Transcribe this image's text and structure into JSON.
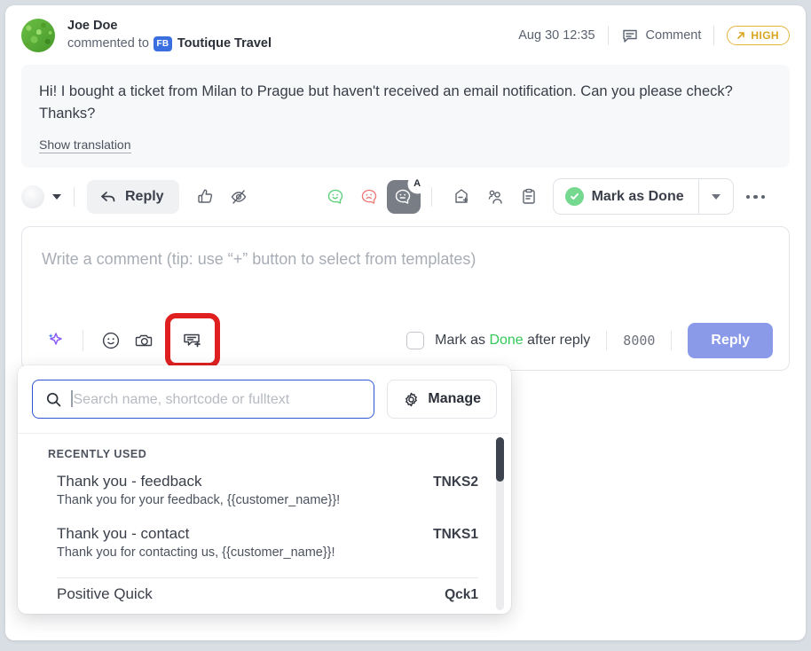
{
  "header": {
    "user_name": "Joe Doe",
    "action_text": "commented to",
    "channel_badge": "FB",
    "channel_name": "Toutique Travel",
    "timestamp": "Aug 30 12:35",
    "type_label": "Comment",
    "priority_label": "HIGH",
    "priority_color": "#d9a520"
  },
  "message": {
    "body": "Hi! I bought a ticket from Milan to Prague but haven't received an email notification. Can you please check? Thanks?",
    "translate_link": "Show translation"
  },
  "toolbar": {
    "reply_label": "Reply",
    "mark_done_label": "Mark as Done",
    "icons": {
      "like": "thumbs-up-icon",
      "hide": "eye-off-icon",
      "positive": "happy-face-bubble-icon",
      "negative": "sad-face-bubble-icon",
      "neutral": "neutral-face-bubble-icon",
      "neutral_badge": "A",
      "tag": "add-tag-icon",
      "assign": "assign-user-icon",
      "notes": "clipboard-icon",
      "more": "more-options-icon"
    }
  },
  "composer": {
    "placeholder": "Write a comment (tip: use “+” button to select from templates)",
    "mark_after_prefix": "Mark as ",
    "mark_after_done": "Done",
    "mark_after_suffix": " after reply",
    "char_counter": "8000",
    "reply_button": "Reply",
    "tools": {
      "ai": "ai-sparkle-icon",
      "emoji": "emoji-icon",
      "attach": "camera-icon",
      "templates": "insert-template-icon"
    },
    "highlight_color": "#e02020",
    "reply_button_color": "#8b9ae8",
    "done_color": "#34c759"
  },
  "templates_dropdown": {
    "search_placeholder": "Search name, shortcode or fulltext",
    "search_value": "",
    "manage_label": "Manage",
    "section_label": "RECENTLY USED",
    "items": [
      {
        "name": "Thank you - feedback",
        "code": "TNKS2",
        "preview": "Thank you for your feedback, {{customer_name}}!"
      },
      {
        "name": "Thank you - contact",
        "code": "TNKS1",
        "preview": "Thank you for contacting us, {{customer_name}}!"
      },
      {
        "name": "Positive Quick",
        "code": "Qck1",
        "preview": ""
      }
    ]
  }
}
